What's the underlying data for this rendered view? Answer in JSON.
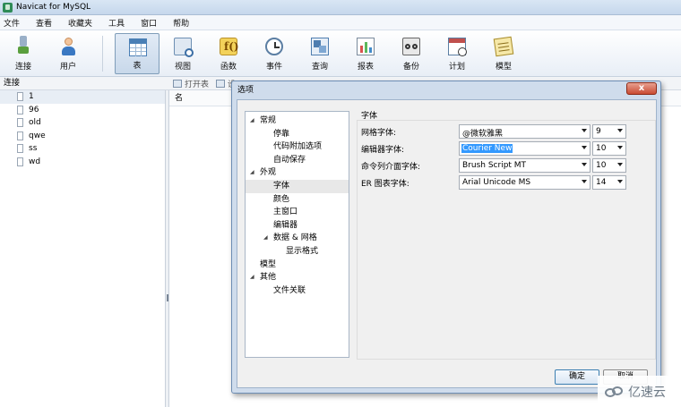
{
  "window": {
    "title": "Navicat for MySQL"
  },
  "menu": [
    "文件",
    "查看",
    "收藏夹",
    "工具",
    "窗口",
    "帮助"
  ],
  "toolbar": {
    "connect": "连接",
    "user": "用户",
    "table": "表",
    "view": "视图",
    "function": "函数",
    "event": "事件",
    "query": "查询",
    "report": "报表",
    "backup": "备份",
    "schedule": "计划",
    "model": "模型"
  },
  "left_panel": {
    "header": "连接",
    "items": [
      "1",
      "96",
      "old",
      "qwe",
      "ss",
      "wd"
    ],
    "selected": "1"
  },
  "object_panel": {
    "toolbar_items": [
      "打开表",
      "设"
    ],
    "column_header": "名"
  },
  "dialog": {
    "title": "选项",
    "close": "x",
    "tree": [
      {
        "label": "常规",
        "level": 0,
        "expanded": true
      },
      {
        "label": "停靠",
        "level": 1
      },
      {
        "label": "代码附加选项",
        "level": 1
      },
      {
        "label": "自动保存",
        "level": 1
      },
      {
        "label": "外观",
        "level": 0,
        "expanded": true
      },
      {
        "label": "字体",
        "level": 1,
        "selected": true
      },
      {
        "label": "颜色",
        "level": 1
      },
      {
        "label": "主窗口",
        "level": 1
      },
      {
        "label": "编辑器",
        "level": 1
      },
      {
        "label": "数据 & 网格",
        "level": 1,
        "expanded": true
      },
      {
        "label": "显示格式",
        "level": 2
      },
      {
        "label": "模型",
        "level": 0
      },
      {
        "label": "其他",
        "level": 0,
        "expanded": true
      },
      {
        "label": "文件关联",
        "level": 1
      }
    ],
    "section_title": "字体",
    "fonts": [
      {
        "label": "网格字体:",
        "font": "@微软雅黑",
        "size": "9"
      },
      {
        "label": "编辑器字体:",
        "font": "Courier New",
        "size": "10",
        "highlighted": true
      },
      {
        "label": "命令列介面字体:",
        "font": "Brush Script MT",
        "size": "10"
      },
      {
        "label": "ER 图表字体:",
        "font": "Arial Unicode MS",
        "size": "14"
      }
    ],
    "ok": "确定",
    "cancel": "取消"
  },
  "watermark": {
    "text": "亿速云"
  }
}
